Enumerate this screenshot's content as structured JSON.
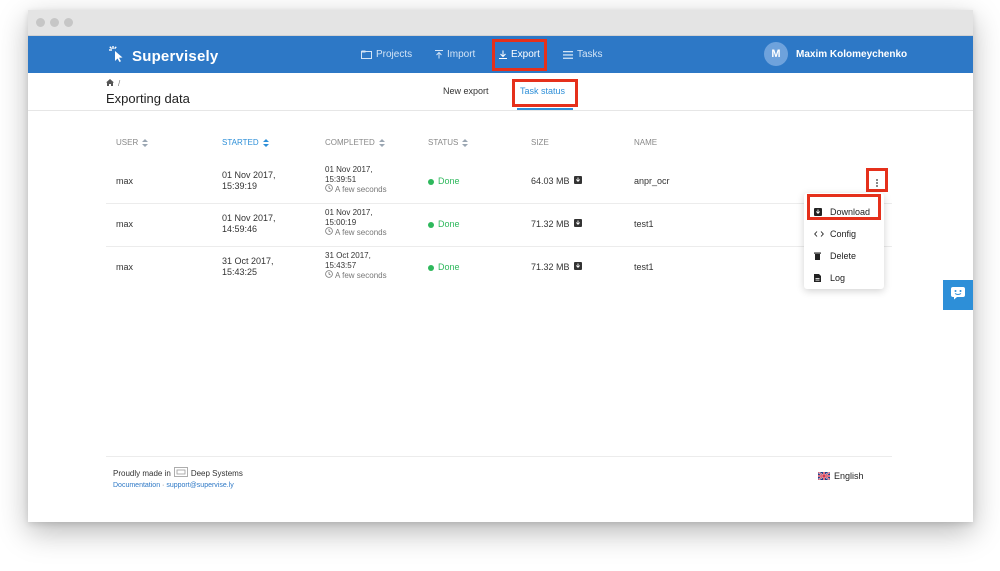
{
  "brand": {
    "name": "Supervisely"
  },
  "nav": {
    "items": [
      {
        "label": "Projects",
        "icon": "folder-icon"
      },
      {
        "label": "Import",
        "icon": "import-icon"
      },
      {
        "label": "Export",
        "icon": "export-icon"
      },
      {
        "label": "Tasks",
        "icon": "list-icon"
      }
    ],
    "active": "Export"
  },
  "user": {
    "initial": "M",
    "name": "Maxim Kolomeychenko"
  },
  "breadcrumb": {
    "separator": "/"
  },
  "page_title": "Exporting data",
  "subtabs": [
    {
      "label": "New export"
    },
    {
      "label": "Task status"
    }
  ],
  "table": {
    "columns": [
      "USER",
      "STARTED",
      "COMPLETED",
      "STATUS",
      "SIZE",
      "NAME"
    ],
    "rows": [
      {
        "user": "max",
        "started_date": "01 Nov 2017,",
        "started_time": "15:39:19",
        "completed_date": "01 Nov 2017,",
        "completed_time": "15:39:51",
        "ago": "A few seconds",
        "status": "Done",
        "size": "64.03 MB",
        "name": "anpr_ocr"
      },
      {
        "user": "max",
        "started_date": "01 Nov 2017,",
        "started_time": "14:59:46",
        "completed_date": "01 Nov 2017,",
        "completed_time": "15:00:19",
        "ago": "A few seconds",
        "status": "Done",
        "size": "71.32 MB",
        "name": "test1"
      },
      {
        "user": "max",
        "started_date": "31 Oct 2017,",
        "started_time": "15:43:25",
        "completed_date": "31 Oct 2017,",
        "completed_time": "15:43:57",
        "ago": "A few seconds",
        "status": "Done",
        "size": "71.32 MB",
        "name": "test1"
      }
    ]
  },
  "row_menu": {
    "items": [
      {
        "label": "Download",
        "icon": "download-icon"
      },
      {
        "label": "Config",
        "icon": "code-icon"
      },
      {
        "label": "Delete",
        "icon": "trash-icon"
      },
      {
        "label": "Log",
        "icon": "file-icon"
      }
    ]
  },
  "footer": {
    "made_prefix": "Proudly made in",
    "company": "Deep Systems",
    "doc_link": "Documentation",
    "link_sep": "·",
    "support_email": "support@supervise.ly",
    "language": "English"
  },
  "colors": {
    "navbar": "#2d78c6",
    "accent": "#2d8fd8",
    "success": "#2eb85c",
    "highlight": "#e5301b"
  }
}
